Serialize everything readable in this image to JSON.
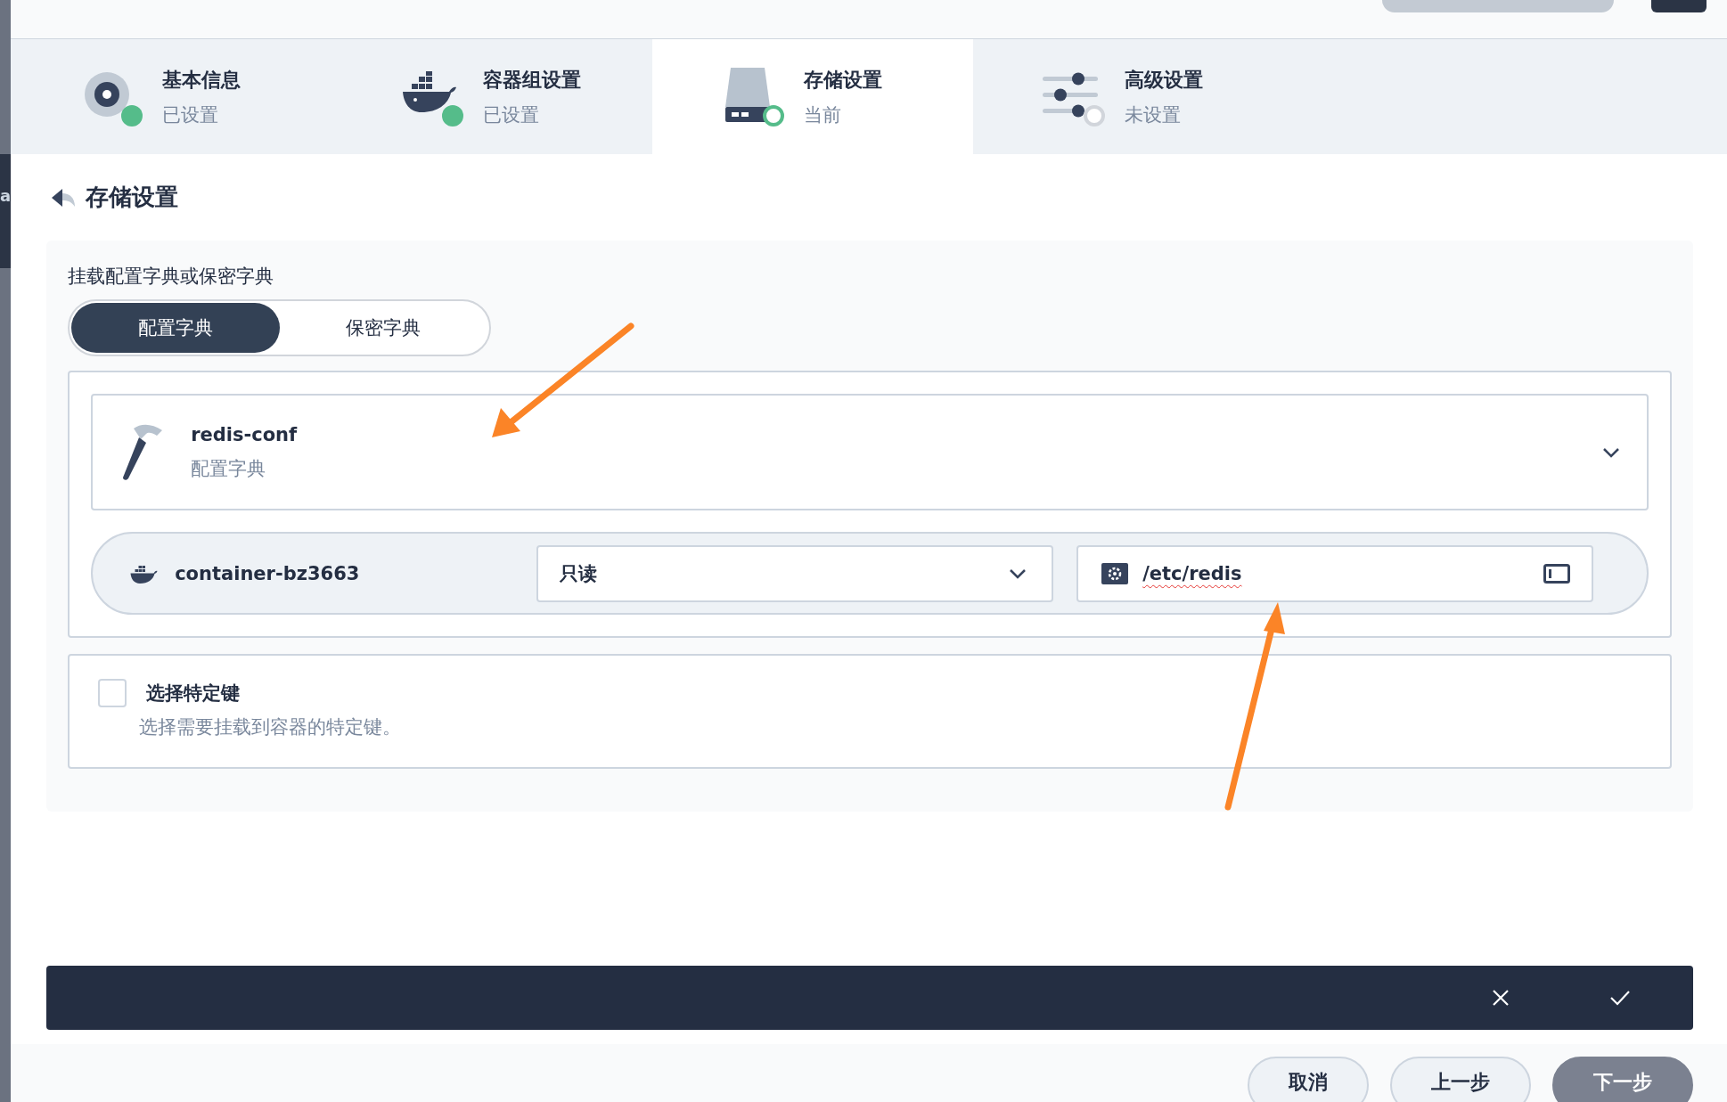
{
  "sidebar_strip": {
    "text": "a"
  },
  "steps": [
    {
      "title": "基本信息",
      "status": "已设置",
      "completed": true,
      "kind": "disc",
      "selected": false
    },
    {
      "title": "容器组设置",
      "status": "已设置",
      "completed": true,
      "kind": "whale",
      "selected": false
    },
    {
      "title": "存储设置",
      "status": "当前",
      "completed": false,
      "kind": "drive",
      "selected": true
    },
    {
      "title": "高级设置",
      "status": "未设置",
      "completed": false,
      "kind": "sliders",
      "selected": false
    }
  ],
  "header": {
    "title": "存储设置"
  },
  "panel": {
    "label": "挂载配置字典或保密字典",
    "tabs": [
      {
        "label": "配置字典",
        "selected": true
      },
      {
        "label": "保密字典",
        "selected": false
      }
    ],
    "resource": {
      "name": "redis-conf",
      "type": "配置字典"
    },
    "mount": {
      "container": "container-bz3663",
      "access": "只读",
      "path": "/etc/redis"
    },
    "specific_keys": {
      "label": "选择特定键",
      "description": "选择需要挂载到容器的特定键。",
      "checked": false
    }
  },
  "footer": {
    "buttons": [
      {
        "label": "取消",
        "kind": "secondary"
      },
      {
        "label": "上一步",
        "kind": "secondary"
      },
      {
        "label": "下一步",
        "kind": "primary"
      }
    ]
  }
}
